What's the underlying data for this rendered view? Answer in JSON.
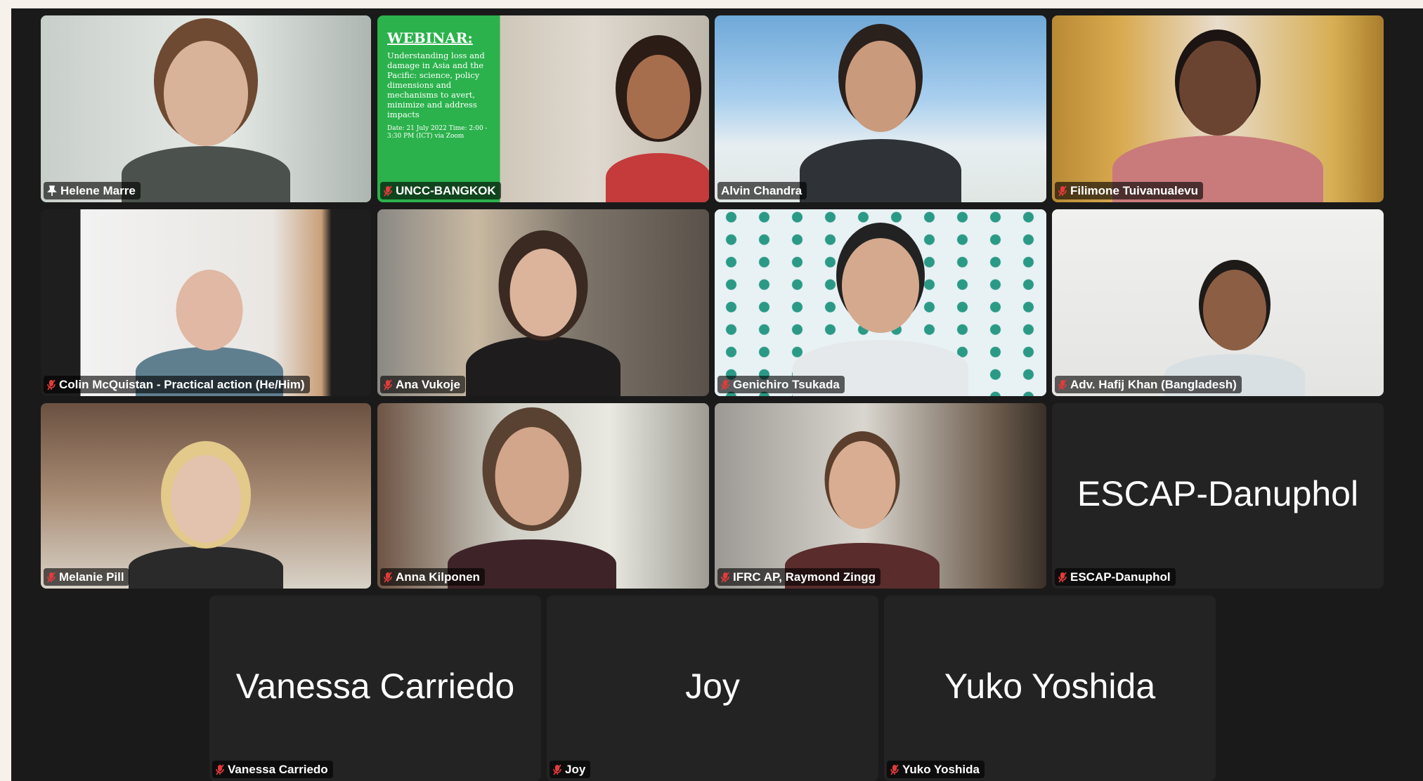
{
  "webinar": {
    "title": "WEBINAR:",
    "body": "Understanding loss and damage in Asia and the Pacific: science, policy dimensions and mechanisms to avert, minimize and address impacts",
    "date": "Date: 21 July 2022 Time: 2:00 - 3:30 PM (ICT) via Zoom"
  },
  "participants": [
    {
      "id": "helene",
      "name": "Helene Marre",
      "muted": false,
      "pinned": true,
      "video": true,
      "active": true
    },
    {
      "id": "unhcr",
      "name": "UNCC-BANGKOK",
      "muted": true,
      "video": true
    },
    {
      "id": "alvin",
      "name": "Alvin Chandra",
      "muted": false,
      "video": true
    },
    {
      "id": "filimone",
      "name": "Filimone Tuivanualevu",
      "muted": true,
      "video": true
    },
    {
      "id": "colin",
      "name": "Colin McQuistan - Practical action (He/Him)",
      "muted": true,
      "video": true
    },
    {
      "id": "ana",
      "name": "Ana Vukoje",
      "muted": true,
      "video": true
    },
    {
      "id": "genichiro",
      "name": "Genichiro Tsukada",
      "muted": true,
      "video": true
    },
    {
      "id": "hafij",
      "name": "Adv. Hafij Khan (Bangladesh)",
      "muted": true,
      "video": true
    },
    {
      "id": "melanie",
      "name": "Melanie Pill",
      "muted": true,
      "video": true
    },
    {
      "id": "anna",
      "name": "Anna Kilponen",
      "muted": true,
      "video": true
    },
    {
      "id": "raymond",
      "name": "IFRC AP, Raymond Zingg",
      "muted": true,
      "video": true
    },
    {
      "id": "escap",
      "name": "ESCAP-Danuphol",
      "display": "ESCAP-Danuphol",
      "muted": true,
      "video": false
    },
    {
      "id": "vanessa",
      "name": "Vanessa Carriedo",
      "display": "Vanessa Carriedo",
      "muted": true,
      "video": false
    },
    {
      "id": "joy",
      "name": "Joy",
      "display": "Joy",
      "muted": true,
      "video": false
    },
    {
      "id": "yuko",
      "name": "Yuko Yoshida",
      "display": "Yuko Yoshida",
      "muted": true,
      "video": false
    }
  ],
  "colors": {
    "window_bg": "#1a1a1a",
    "tile_bg": "#232323",
    "active_speaker_border": "#3fbf5a",
    "muted_icon": "#e23b3b",
    "webinar_green": "#2bb24c"
  },
  "icons": {
    "muted": "mic-muted-icon",
    "pinned": "pin-icon"
  }
}
